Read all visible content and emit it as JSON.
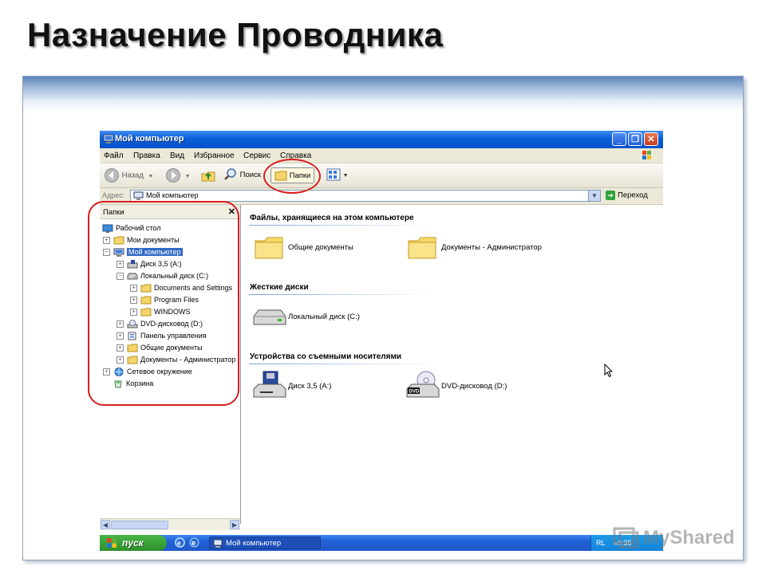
{
  "slide": {
    "title": "Назначение Проводника"
  },
  "window": {
    "title": "Мой компьютер",
    "buttons": {
      "minimize": "_",
      "maximize": "❐",
      "close": "✕"
    }
  },
  "menu": [
    "Файл",
    "Правка",
    "Вид",
    "Избранное",
    "Сервис",
    "Справка"
  ],
  "toolbar": {
    "back": "Назад",
    "search": "Поиск",
    "folders": "Папки"
  },
  "address": {
    "label": "Адрес:",
    "value": "Мой компьютер",
    "go": "Переход"
  },
  "folders_pane": {
    "title": "Папки",
    "close": "✕",
    "tree": [
      {
        "label": "Рабочий стол",
        "icon": "desktop-icon",
        "expander": ""
      },
      {
        "label": "Мои документы",
        "icon": "folder-icon",
        "expander": "+"
      },
      {
        "label": "Мой компьютер",
        "icon": "computer-icon",
        "expander": "−",
        "selected": true
      },
      {
        "label": "Диск 3,5 (A:)",
        "icon": "floppy-drive-icon",
        "expander": "+"
      },
      {
        "label": "Локальный диск (C:)",
        "icon": "hard-drive-icon",
        "expander": "−"
      },
      {
        "label": "Documents and Settings",
        "icon": "folder-icon",
        "expander": "+"
      },
      {
        "label": "Program Files",
        "icon": "folder-icon",
        "expander": "+"
      },
      {
        "label": "WINDOWS",
        "icon": "folder-icon",
        "expander": "+"
      },
      {
        "label": "DVD-дисковод (D:)",
        "icon": "dvd-drive-icon",
        "expander": "+"
      },
      {
        "label": "Панель управления",
        "icon": "control-panel-icon",
        "expander": "+"
      },
      {
        "label": "Общие документы",
        "icon": "folder-icon",
        "expander": "+"
      },
      {
        "label": "Документы - Администратор",
        "icon": "folder-icon",
        "expander": "+"
      },
      {
        "label": "Сетевое окружение",
        "icon": "network-icon",
        "expander": "+"
      },
      {
        "label": "Корзина",
        "icon": "recycle-bin-icon",
        "expander": ""
      }
    ]
  },
  "content": {
    "groups": [
      {
        "title": "Файлы, хранящиеся на этом компьютере",
        "items": [
          {
            "label": "Общие документы",
            "icon": "folder-icon"
          },
          {
            "label": "Документы - Администратор",
            "icon": "folder-icon"
          }
        ]
      },
      {
        "title": "Жесткие диски",
        "items": [
          {
            "label": "Локальный диск (C:)",
            "icon": "hard-drive-icon"
          }
        ]
      },
      {
        "title": "Устройства со съемными носителями",
        "items": [
          {
            "label": "Диск 3,5 (A:)",
            "icon": "floppy-drive-icon"
          },
          {
            "label": "DVD-дисковод (D:)",
            "icon": "dvd-drive-icon"
          }
        ]
      }
    ]
  },
  "taskbar": {
    "start": "пуск",
    "task": "Мой компьютер",
    "tray_lang": "RL",
    "tray_clock": "«0:35"
  },
  "watermark": {
    "text": "MyShared"
  },
  "colors": {
    "selection": "#316ac5",
    "annotation": "#d81e1e",
    "title_blue": "#0a5fd8",
    "start_green": "#2d8f2c"
  }
}
